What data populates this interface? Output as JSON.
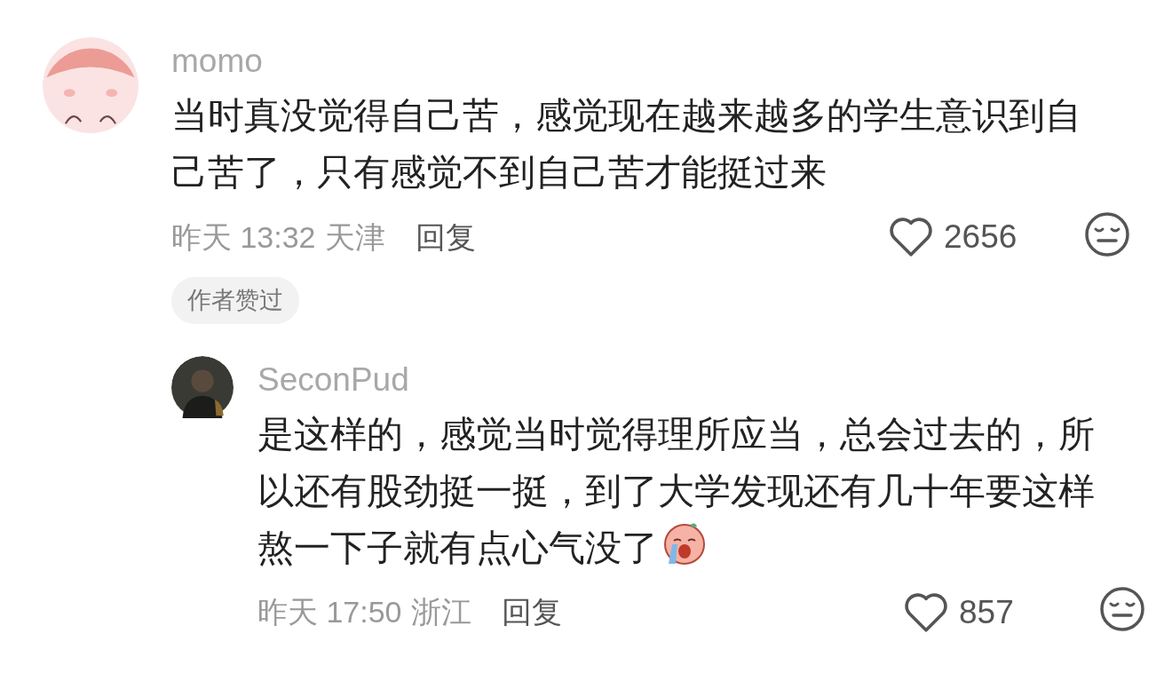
{
  "comments": [
    {
      "user": "momo",
      "text": "当时真没觉得自己苦，感觉现在越来越多的学生意识到自己苦了，只有感觉不到自己苦才能挺过来",
      "trailing_emoji": false,
      "time": "昨天 13:32",
      "location": "天津",
      "reply": "回复",
      "likes": "2656",
      "liked": false,
      "badge": "作者赞过",
      "replies": [
        {
          "user": "SeconPud",
          "text": "是这样的，感觉当时觉得理所应当，总会过去的，所以还有股劲挺一挺，到了大学发现还有几十年要这样熬一下子就有点心气没了",
          "trailing_emoji": true,
          "time": "昨天 17:50",
          "location": "浙江",
          "reply": "回复",
          "likes": "857",
          "liked": false
        }
      ]
    }
  ]
}
